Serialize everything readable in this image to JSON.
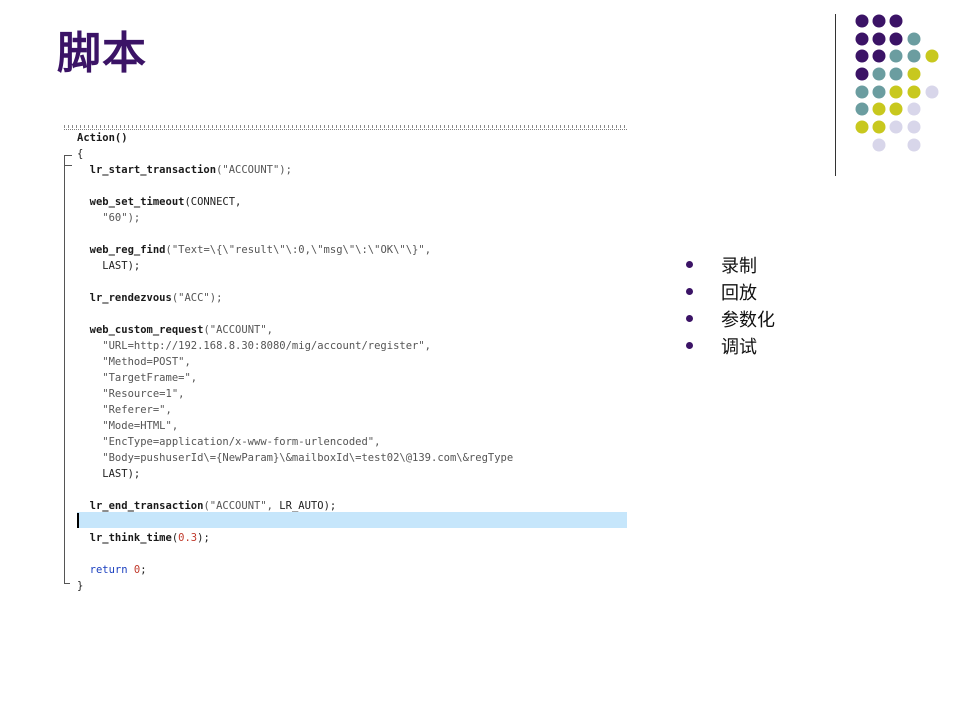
{
  "slide": {
    "title": "脚本",
    "bullets": [
      "录制",
      "回放",
      "参数化",
      "调试"
    ]
  },
  "code": {
    "lines": [
      [
        [
          "Action()",
          "fn"
        ]
      ],
      [
        [
          "{",
          "plain"
        ]
      ],
      [
        [
          "  lr_start_transaction",
          "fn"
        ],
        [
          "(\"ACCOUNT\");",
          "str"
        ]
      ],
      [
        [
          "",
          "plain"
        ]
      ],
      [
        [
          "  web_set_timeout",
          "fn"
        ],
        [
          "(CONNECT,",
          "plain"
        ]
      ],
      [
        [
          "    \"60\");",
          "str"
        ]
      ],
      [
        [
          "",
          "plain"
        ]
      ],
      [
        [
          "  web_reg_find",
          "fn"
        ],
        [
          "(\"Text=\\{\\\"result\\\"\\:0,\\\"msg\\\"\\:\\\"OK\\\"\\}\",",
          "str"
        ]
      ],
      [
        [
          "    LAST);",
          "plain"
        ]
      ],
      [
        [
          "",
          "plain"
        ]
      ],
      [
        [
          "  lr_rendezvous",
          "fn"
        ],
        [
          "(\"ACC\");",
          "str"
        ]
      ],
      [
        [
          "",
          "plain"
        ]
      ],
      [
        [
          "  web_custom_request",
          "fn"
        ],
        [
          "(\"ACCOUNT\",",
          "str"
        ]
      ],
      [
        [
          "    \"URL=http://192.168.8.30:8080/mig/account/register\",",
          "str"
        ]
      ],
      [
        [
          "    \"Method=POST\",",
          "str"
        ]
      ],
      [
        [
          "    \"TargetFrame=\",",
          "str"
        ]
      ],
      [
        [
          "    \"Resource=1\",",
          "str"
        ]
      ],
      [
        [
          "    \"Referer=\",",
          "str"
        ]
      ],
      [
        [
          "    \"Mode=HTML\",",
          "str"
        ]
      ],
      [
        [
          "    \"EncType=application/x-www-form-urlencoded\",",
          "str"
        ]
      ],
      [
        [
          "    \"Body=pushuserId\\={NewParam}\\&mailboxId\\=test02\\@139.com\\&regType",
          "str"
        ]
      ],
      [
        [
          "    LAST);",
          "plain"
        ]
      ],
      [
        [
          "",
          "plain"
        ]
      ],
      [
        [
          "  lr_end_transaction",
          "fn"
        ],
        [
          "(\"ACCOUNT\", ",
          "str"
        ],
        [
          "LR_AUTO",
          "plain"
        ],
        [
          ");",
          "plain"
        ]
      ],
      [
        [
          "",
          "plain"
        ]
      ],
      [
        [
          "  lr_think_time",
          "fn"
        ],
        [
          "(",
          "plain"
        ],
        [
          "0.3",
          "num"
        ],
        [
          ");",
          "plain"
        ]
      ],
      [
        [
          "",
          "plain"
        ]
      ],
      [
        [
          "  return",
          "kw"
        ],
        [
          " ",
          "plain"
        ],
        [
          "0",
          "num"
        ],
        [
          ";",
          "plain"
        ]
      ],
      [
        [
          "}",
          "plain"
        ]
      ]
    ]
  },
  "colors": {
    "title": "#3b1366",
    "dot_purple": "#3b1366",
    "dot_teal": "#6b9da0",
    "dot_lime": "#c8c81e",
    "dot_lavender": "#d8d6ea",
    "highlight": "#c6e6fb"
  }
}
